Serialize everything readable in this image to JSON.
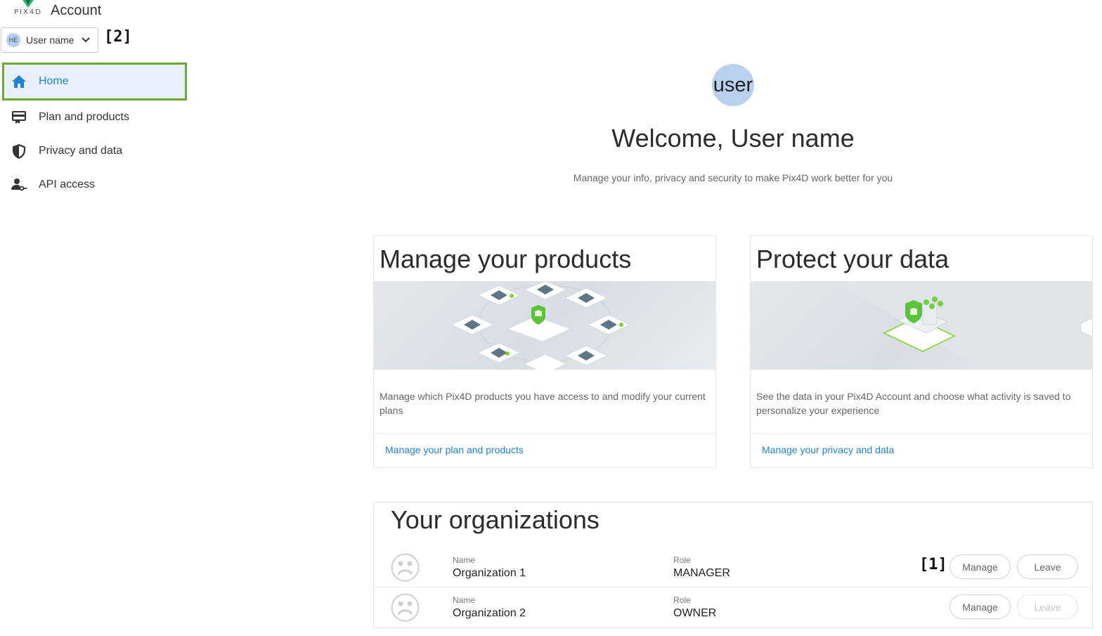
{
  "header": {
    "logo_text": "PIX4D",
    "app_title": "Account"
  },
  "user_menu": {
    "initials": "HE",
    "label": "User name"
  },
  "markers": {
    "m1": "[1]",
    "m2": "[2]"
  },
  "sidebar": {
    "items": [
      {
        "label": "Home",
        "icon": "home-icon",
        "active": true
      },
      {
        "label": "Plan and products",
        "icon": "plan-icon",
        "active": false
      },
      {
        "label": "Privacy and data",
        "icon": "shield-icon",
        "active": false
      },
      {
        "label": "API access",
        "icon": "api-key-icon",
        "active": false
      }
    ]
  },
  "hero": {
    "avatar_text": "user",
    "welcome": "Welcome, User name",
    "subtitle": "Manage your info, privacy and security to make Pix4D work better for you"
  },
  "cards": [
    {
      "title": "Manage your products",
      "description": "Manage which Pix4D products you have access to and modify your current plans",
      "link": "Manage your plan and products"
    },
    {
      "title": "Protect your data",
      "description": "See the data in your Pix4D Account and choose what activity is saved to personalize your experience",
      "link": "Manage your privacy and data"
    }
  ],
  "organizations": {
    "title": "Your organizations",
    "name_label": "Name",
    "role_label": "Role",
    "manage_label": "Manage",
    "leave_label": "Leave",
    "rows": [
      {
        "name": "Organization 1",
        "role": "MANAGER",
        "leave_enabled": true
      },
      {
        "name": "Organization 2",
        "role": "OWNER",
        "leave_enabled": false
      }
    ]
  },
  "colors": {
    "accent": "#1f83d6",
    "active_bg": "#e8f1fb",
    "highlight_outline": "#6aa83a",
    "avatar_bg": "#b9d0ee"
  }
}
